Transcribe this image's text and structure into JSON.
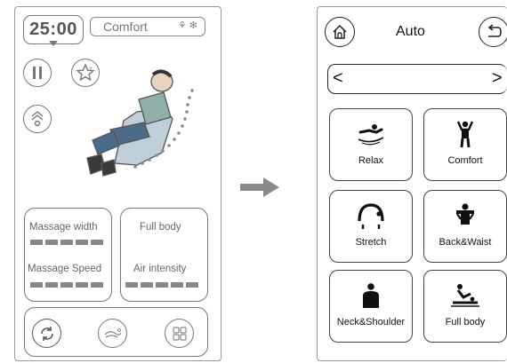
{
  "left_screen": {
    "timer": "25:00",
    "mode": "Comfort",
    "massage_width_label": "Massage width",
    "massage_speed_label": "Massage Speed",
    "full_body_label": "Full body",
    "air_intensity_label": "Air intensity",
    "icons": [
      "pause-icon",
      "star-plus-icon",
      "airflow-icon",
      "sync-icon",
      "foot-massage-icon",
      "grid-menu-icon"
    ]
  },
  "right_screen": {
    "title": "Auto",
    "nav_prev": "<",
    "nav_next": ">",
    "programs": [
      {
        "label": "Relax",
        "icon": "relax-icon"
      },
      {
        "label": "Comfort",
        "icon": "comfort-icon"
      },
      {
        "label": "Stretch",
        "icon": "stretch-icon"
      },
      {
        "label": "Back&Waist",
        "icon": "back-waist-icon"
      },
      {
        "label": "Neck&Shoulder",
        "icon": "neck-shoulder-icon"
      },
      {
        "label": "Full body",
        "icon": "full-body-icon"
      }
    ]
  },
  "colors": {
    "outline": "#777777",
    "arrow": "#8a8a8a",
    "text": "#222222"
  }
}
